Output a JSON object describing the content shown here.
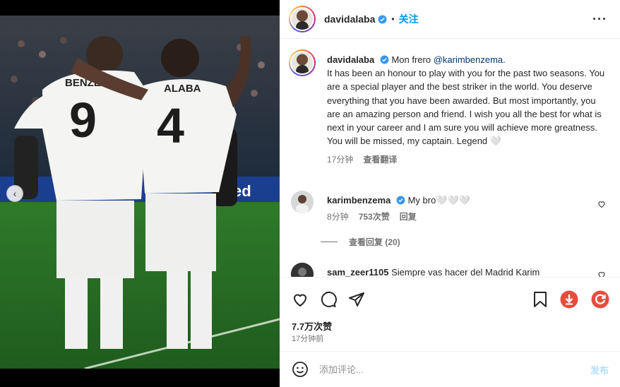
{
  "post": {
    "username": "davidalaba",
    "follow_label": "关注",
    "more_label": "···"
  },
  "caption": {
    "username": "davidalaba",
    "first_line": "Mon frero ",
    "mention": "@karimbenzema",
    "first_line_end": ".",
    "text": "It has been an honour to play with you for the past two seasons. You are a special player and the best striker in the world. You deserve everything that you have been awarded. But most importantly, you are an amazing person and friend. I wish you all the best for what is next in your career and I am sure you will achieve more greatness.",
    "closing": "You will be missed, my captain. Legend 🤍",
    "time": "17分钟",
    "translate_label": "查看翻译"
  },
  "comments": [
    {
      "username": "karimbenzema",
      "text": "My bro🤍🤍🤍",
      "time": "8分钟",
      "likes": "753次赞",
      "reply_label": "回复",
      "view_replies": "查看回复 (20)"
    },
    {
      "username": "sam_zeer1105",
      "text": "Siempre vas hacer del Madrid Karim"
    }
  ],
  "footer": {
    "likes": "7.7万次赞",
    "time_ago": "17分钟前",
    "comment_placeholder": "添加评论...",
    "post_label": "发布"
  },
  "photo": {
    "jersey_left_name": "BENZEMA",
    "jersey_left_number": "9",
    "jersey_right_name": "ALABA",
    "jersey_right_number": "4"
  },
  "colors": {
    "accent": "#0095f6",
    "verified": "#3897f0",
    "download": "#e74c3c",
    "refresh": "#e74c3c"
  }
}
